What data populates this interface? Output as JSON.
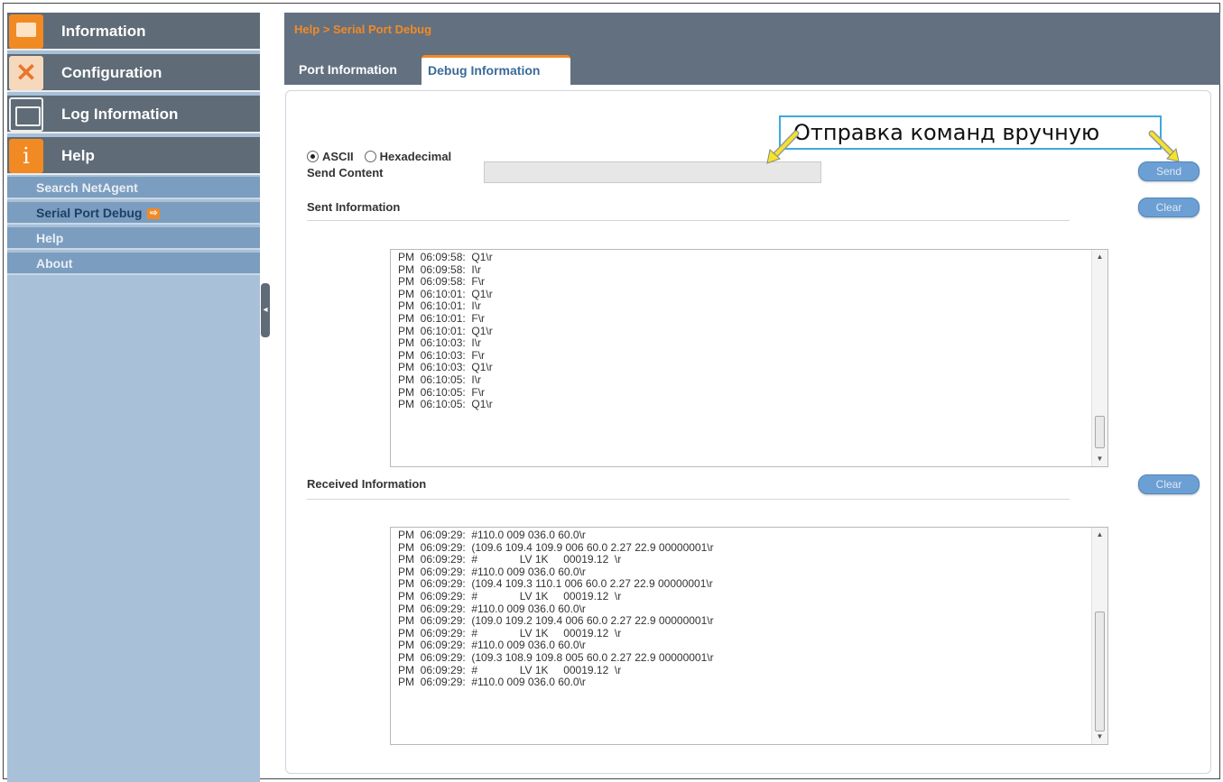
{
  "sidebar": {
    "main_items": [
      {
        "label": "Information",
        "icon": "monitor-icon"
      },
      {
        "label": "Configuration",
        "icon": "tools-icon"
      },
      {
        "label": "Log Information",
        "icon": "folder-icon"
      },
      {
        "label": "Help",
        "icon": "info-icon"
      }
    ],
    "sub_items": [
      {
        "label": "Search NetAgent"
      },
      {
        "label": "Serial Port Debug"
      },
      {
        "label": "Help"
      },
      {
        "label": "About"
      }
    ],
    "collapse_glyph": "◂"
  },
  "header": {
    "breadcrumb": "Help > Serial Port Debug",
    "tabs": [
      {
        "label": "Port Information"
      },
      {
        "label": "Debug Information"
      }
    ]
  },
  "form": {
    "mode_ascii": "ASCII",
    "mode_hex": "Hexadecimal",
    "send_content_label": "Send Content",
    "send_content_value": "",
    "send_button": "Send",
    "sent_label": "Sent Information",
    "received_label": "Received Information",
    "clear_button": "Clear"
  },
  "sent_log": [
    "PM  06:09:58:  Q1\\r",
    "PM  06:09:58:  I\\r",
    "PM  06:09:58:  F\\r",
    "PM  06:10:01:  Q1\\r",
    "PM  06:10:01:  I\\r",
    "PM  06:10:01:  F\\r",
    "PM  06:10:01:  Q1\\r",
    "PM  06:10:03:  I\\r",
    "PM  06:10:03:  F\\r",
    "PM  06:10:03:  Q1\\r",
    "PM  06:10:05:  I\\r",
    "PM  06:10:05:  F\\r",
    "PM  06:10:05:  Q1\\r"
  ],
  "received_log": [
    "PM  06:09:29:  #110.0 009 036.0 60.0\\r",
    "PM  06:09:29:  (109.6 109.4 109.9 006 60.0 2.27 22.9 00000001\\r",
    "PM  06:09:29:  #              LV 1K     00019.12  \\r",
    "PM  06:09:29:  #110.0 009 036.0 60.0\\r",
    "PM  06:09:29:  (109.4 109.3 110.1 006 60.0 2.27 22.9 00000001\\r",
    "PM  06:09:29:  #              LV 1K     00019.12  \\r",
    "PM  06:09:29:  #110.0 009 036.0 60.0\\r",
    "PM  06:09:29:  (109.0 109.2 109.4 006 60.0 2.27 22.9 00000001\\r",
    "PM  06:09:29:  #              LV 1K     00019.12  \\r",
    "PM  06:09:29:  #110.0 009 036.0 60.0\\r",
    "PM  06:09:29:  (109.3 108.9 109.8 005 60.0 2.27 22.9 00000001\\r",
    "PM  06:09:29:  #              LV 1K     00019.12  \\r",
    "PM  06:09:29:  #110.0 009 036.0 60.0\\r"
  ],
  "annotation": {
    "text": "Отправка команд вручную",
    "border_color": "#3fa9e0",
    "arrow_color": "#f4e32a"
  },
  "colors": {
    "accent": "#f28a24",
    "header_bg": "#637080",
    "sidebar_bg": "#a8c0d8",
    "button_bg": "#6c9fd3"
  }
}
